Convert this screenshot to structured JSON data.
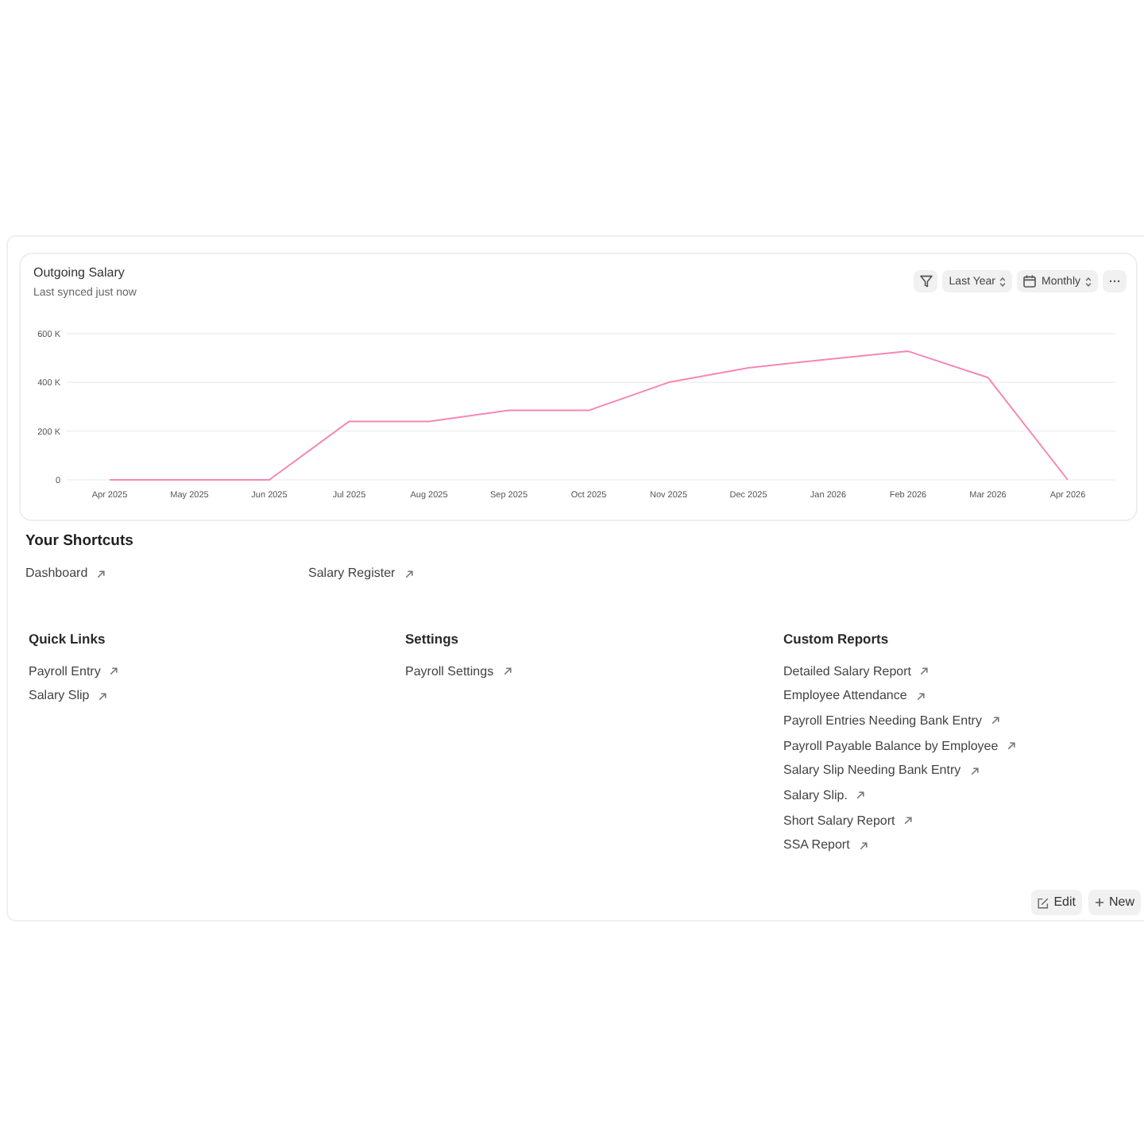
{
  "chart_card": {
    "title": "Outgoing Salary",
    "subtitle": "Last synced just now",
    "controls": [
      {
        "kind": "filter"
      },
      {
        "kind": "range-select",
        "label": "Last Year"
      },
      {
        "kind": "period-select",
        "label": "Monthly"
      },
      {
        "kind": "more"
      }
    ],
    "chart_data": {
      "type": "line",
      "categories": [
        "Apr 2025",
        "May 2025",
        "Jun 2025",
        "Jul 2025",
        "Aug 2025",
        "Sep 2025",
        "Oct 2025",
        "Nov 2025",
        "Dec 2025",
        "Jan 2026",
        "Feb 2026",
        "Mar 2026",
        "Apr 2026"
      ],
      "series": [
        {
          "color": "#f687b3",
          "values": [
            0,
            0,
            0,
            240000,
            240000,
            285000,
            285000,
            400000,
            460000,
            495000,
            528000,
            420000,
            0
          ]
        }
      ],
      "ylim": [
        0,
        600000
      ],
      "yticks": [
        {
          "value": 0,
          "label": "0"
        },
        {
          "value": 200000,
          "label": "200 K"
        },
        {
          "value": 400000,
          "label": "400 K"
        },
        {
          "value": 600000,
          "label": "600 K"
        }
      ]
    }
  },
  "shortcuts": {
    "title": "Your Shortcuts",
    "items": [
      "Dashboard",
      "Salary Register"
    ]
  },
  "link_cards": [
    {
      "title": "Quick Links",
      "links": [
        "Payroll Entry",
        "Salary Slip"
      ]
    },
    {
      "title": "Settings",
      "links": [
        "Payroll Settings"
      ]
    },
    {
      "title": "Custom Reports",
      "links": [
        "Detailed Salary Report",
        "Employee Attendance",
        "Payroll Entries Needing Bank Entry",
        "Payroll Payable Balance by Employee",
        "Salary Slip Needing Bank Entry",
        "Salary Slip.",
        "Short Salary Report",
        "SSA Report"
      ]
    }
  ],
  "actions": [
    {
      "kind": "edit",
      "label": "Edit"
    },
    {
      "kind": "new",
      "label": "New"
    }
  ]
}
